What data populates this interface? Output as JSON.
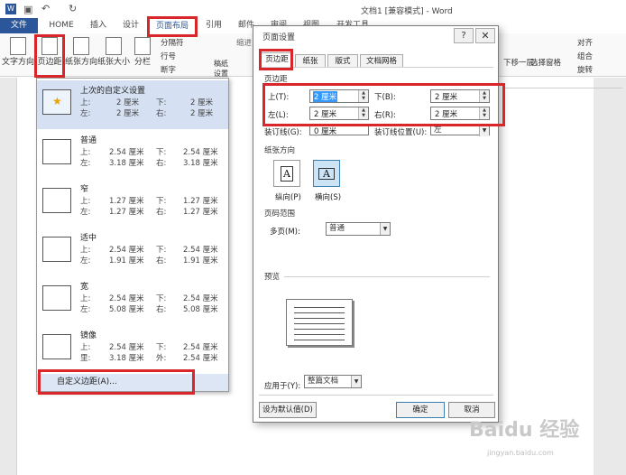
{
  "app": {
    "title": "文档1 [兼容模式] - Word"
  },
  "tabs": [
    "文件",
    "HOME",
    "插入",
    "设计",
    "页面布局",
    "引用",
    "邮件",
    "审阅",
    "视图",
    "开发工具"
  ],
  "ribbon": {
    "text_direction": "文字方向",
    "margins": "页边距",
    "orientation": "纸张方向",
    "size": "纸张大小",
    "columns": "分栏",
    "breaks": "分隔符",
    "line_numbers": "行号",
    "hyphenation": "断字",
    "draft": "稿纸设置",
    "indent": "缩进",
    "arrange": {
      "align": "对齐",
      "group": "组合",
      "rotate": "旋转",
      "select_pane": "选择窗格",
      "send_back": "下移一层"
    }
  },
  "margin_menu": {
    "items": [
      {
        "name": "上次的自定义设置",
        "top": "2 厘米",
        "bottom": "2 厘米",
        "left": "2 厘米",
        "right": "2 厘米",
        "k1": "上:",
        "k2": "下:",
        "k3": "左:",
        "k4": "右:"
      },
      {
        "name": "普通",
        "top": "2.54 厘米",
        "bottom": "2.54 厘米",
        "left": "3.18 厘米",
        "right": "3.18 厘米",
        "k1": "上:",
        "k2": "下:",
        "k3": "左:",
        "k4": "右:"
      },
      {
        "name": "窄",
        "top": "1.27 厘米",
        "bottom": "1.27 厘米",
        "left": "1.27 厘米",
        "right": "1.27 厘米",
        "k1": "上:",
        "k2": "下:",
        "k3": "左:",
        "k4": "右:"
      },
      {
        "name": "适中",
        "top": "2.54 厘米",
        "bottom": "2.54 厘米",
        "left": "1.91 厘米",
        "right": "1.91 厘米",
        "k1": "上:",
        "k2": "下:",
        "k3": "左:",
        "k4": "右:"
      },
      {
        "name": "宽",
        "top": "2.54 厘米",
        "bottom": "2.54 厘米",
        "left": "5.08 厘米",
        "right": "5.08 厘米",
        "k1": "上:",
        "k2": "下:",
        "k3": "左:",
        "k4": "右:"
      },
      {
        "name": "镜像",
        "top": "2.54 厘米",
        "bottom": "2.54 厘米",
        "left": "3.18 厘米",
        "right": "2.54 厘米",
        "k1": "上:",
        "k2": "下:",
        "k3": "里:",
        "k4": "外:"
      }
    ],
    "custom": "自定义边距(A)..."
  },
  "dialog": {
    "title": "页面设置",
    "help": "?",
    "close": "✕",
    "tabs": [
      "页边距",
      "纸张",
      "版式",
      "文档网格"
    ],
    "margins_section": "页边距",
    "top_label": "上(T):",
    "top_value": "2 厘米",
    "bottom_label": "下(B):",
    "bottom_value": "2 厘米",
    "left_label": "左(L):",
    "left_value": "2 厘米",
    "right_label": "右(R):",
    "right_value": "2 厘米",
    "gutter_label": "装订线(G):",
    "gutter_value": "0 厘米",
    "gutter_pos_label": "装订线位置(U):",
    "gutter_pos_value": "左",
    "orientation_section": "纸张方向",
    "portrait": "纵向(P)",
    "landscape": "横向(S)",
    "pages_section": "页码范围",
    "multi_label": "多页(M):",
    "multi_value": "普通",
    "preview_section": "预览",
    "apply_label": "应用于(Y):",
    "apply_value": "整篇文档",
    "default_btn": "设为默认值(D)",
    "ok": "确定",
    "cancel": "取消"
  },
  "watermark": {
    "brand": "Baidu 经验",
    "url": "jingyan.baidu.com"
  },
  "colors": {
    "file_tab": "#2b579a",
    "highlight": "#d9262b",
    "selection": "#3399ff"
  }
}
